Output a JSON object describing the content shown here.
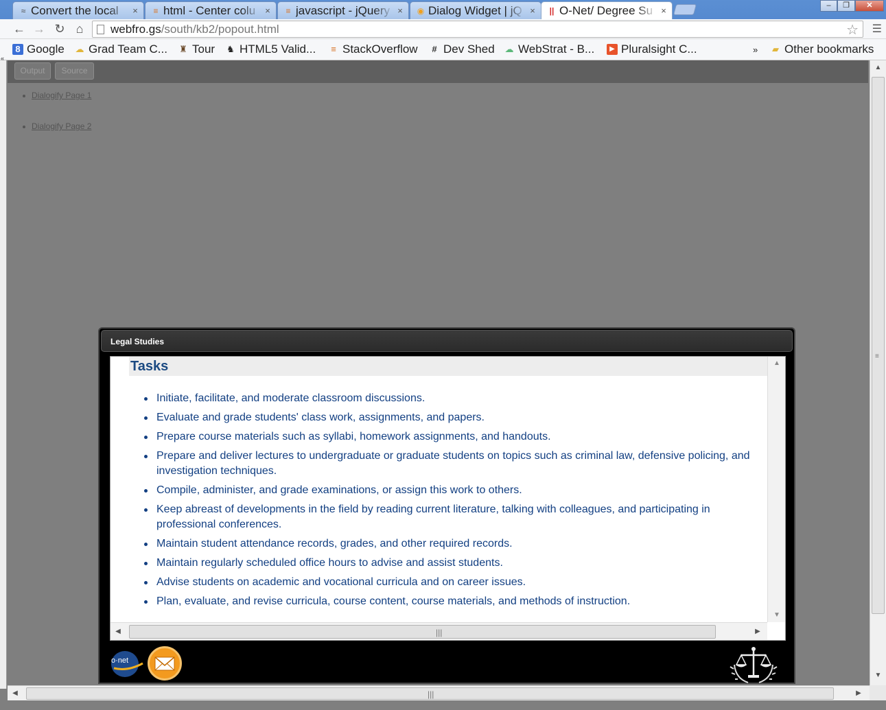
{
  "browser": {
    "tabs": [
      {
        "title": "Convert the local",
        "icon": "stackexchange-icon"
      },
      {
        "title": "html - Center colu",
        "icon": "stackoverflow-icon"
      },
      {
        "title": "javascript - jQuery",
        "icon": "stackoverflow-icon"
      },
      {
        "title": "Dialog Widget | jQ",
        "icon": "jquery-icon"
      },
      {
        "title": "O-Net/ Degree Su",
        "icon": "onet-icon",
        "active": true
      }
    ],
    "url_host": "webfro.gs",
    "url_path": "/south/kb2/popout.html",
    "bookmarks": [
      {
        "label": "Google"
      },
      {
        "label": "Grad Team C..."
      },
      {
        "label": "Tour"
      },
      {
        "label": "HTML5 Valid..."
      },
      {
        "label": "StackOverflow"
      },
      {
        "label": "Dev Shed"
      },
      {
        "label": "WebStrat - B..."
      },
      {
        "label": "Pluralsight C..."
      }
    ],
    "bookmarks_overflow": "»",
    "other_bookmarks": "Other bookmarks"
  },
  "page": {
    "header_buttons": {
      "output": "Output",
      "source": "Source"
    },
    "links": [
      "Dialogify Page 1",
      "Dialogify Page 2"
    ]
  },
  "dialog": {
    "title": "Legal Studies",
    "heading": "Tasks",
    "tasks": [
      "Initiate, facilitate, and moderate classroom discussions.",
      "Evaluate and grade students' class work, assignments, and papers.",
      "Prepare course materials such as syllabi, homework assignments, and handouts.",
      "Prepare and deliver lectures to undergraduate or graduate students on topics such as criminal law, defensive policing, and investigation techniques.",
      "Compile, administer, and grade examinations, or assign this work to others.",
      "Keep abreast of developments in the field by reading current literature, talking with colleagues, and participating in professional conferences.",
      "Maintain student attendance records, grades, and other required records.",
      "Maintain regularly scheduled office hours to advise and assist students.",
      "Advise students on academic and vocational curricula and on career issues.",
      "Plan, evaluate, and revise curricula, course content, course materials, and methods of instruction."
    ],
    "logo_text": "o·net"
  },
  "colors": {
    "task_text": "#123f82",
    "heading_text": "#1b4a82",
    "page_bg": "#7f7f7f",
    "mail_orange": "#f39a1f"
  }
}
